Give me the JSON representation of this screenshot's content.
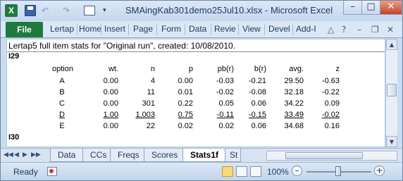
{
  "app": {
    "logo": "X",
    "title": "SMAingKab301demo25Jul10.xlsx  -  Microsoft Excel",
    "controls": {
      "minimize": "–",
      "maximize": "□",
      "close": "✕"
    },
    "quick_access": {
      "undo": "↶",
      "redo": "↷",
      "dropdown": "▾"
    }
  },
  "ribbon": {
    "file": "File",
    "tabs": [
      "Lertap",
      "Home",
      "Insert",
      "Page",
      "Form",
      "Data",
      "Revie",
      "View",
      "Devel",
      "Add-I"
    ],
    "icons": {
      "help": "?",
      "minimize_ribbon": "△",
      "window_min": "–",
      "window_restore": "❐",
      "window_close": "✕"
    }
  },
  "sheet": {
    "caption": "Lertap5 full item stats for \"Original run\", created: 10/08/2010.",
    "item_label": "I29",
    "next_item_label": "I30",
    "columns": [
      "option",
      "wt.",
      "n",
      "p",
      "pb(r)",
      "b(r)",
      "avg.",
      "z"
    ],
    "rows": [
      {
        "option": "A",
        "wt": "0.00",
        "n": "4",
        "p": "0.00",
        "pbr": "-0.03",
        "br": "-0.21",
        "avg": "29.50",
        "z": "-0.63",
        "key": false
      },
      {
        "option": "B",
        "wt": "0.00",
        "n": "11",
        "p": "0.01",
        "pbr": "-0.02",
        "br": "-0.08",
        "avg": "32.18",
        "z": "-0.22",
        "key": false
      },
      {
        "option": "C",
        "wt": "0.00",
        "n": "301",
        "p": "0.22",
        "pbr": "0.05",
        "br": "0.06",
        "avg": "34.22",
        "z": "0.09",
        "key": false
      },
      {
        "option": "D",
        "wt": "1.00",
        "n": "1,003",
        "p": "0.75",
        "pbr": "-0.11",
        "br": "-0.15",
        "avg": "33.49",
        "z": "-0.02",
        "key": true
      },
      {
        "option": "E",
        "wt": "0.00",
        "n": "22",
        "p": "0.02",
        "pbr": "0.02",
        "br": "0.06",
        "avg": "34.68",
        "z": "0.16",
        "key": false
      }
    ]
  },
  "sheet_tabs": [
    "Data",
    "CCs",
    "Freqs",
    "Scores",
    "Stats1f",
    "St"
  ],
  "active_sheet_tab": "Stats1f",
  "sheet_nav": [
    "◀◀",
    "◀",
    "▶",
    "▶▶"
  ],
  "status": {
    "ready": "Ready",
    "zoom": "100%",
    "zoom_minus": "–",
    "zoom_plus": "+",
    "zoom_level": 1.0
  }
}
